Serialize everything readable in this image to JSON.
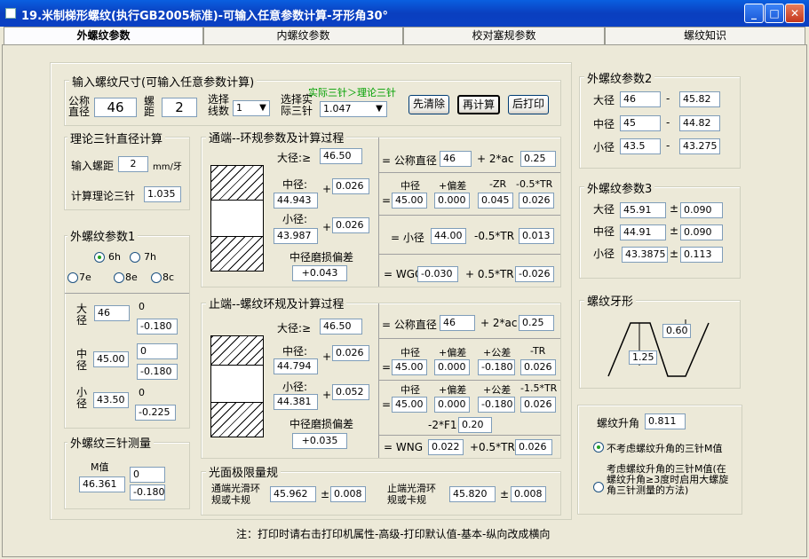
{
  "window": {
    "title": "19.米制梯形螺纹(执行GB2005标准)-可输入任意参数计算-牙形角30°"
  },
  "tabs": [
    "外螺纹参数",
    "内螺纹参数",
    "校对塞规参数",
    "螺纹知识"
  ],
  "input_group": {
    "title": "输入螺纹尺寸(可输入任意参数计算)",
    "nominal_label": "公称直径",
    "nominal_value": "46",
    "pitch_label": "螺距",
    "pitch_value": "2",
    "thread_count_label": "选择线数",
    "thread_count_value": "1",
    "actual_pin_label": "选择实际三针",
    "actual_pin_value": "1.047",
    "pin_note": "实际三针＞理论三针",
    "clear_button": "先清除",
    "recalc_button": "再计算",
    "print_button": "后打印"
  },
  "theory_pin": {
    "title": "理论三针直径计算",
    "pitch_label": "输入螺距",
    "pitch_value": "2",
    "unit": "mm/牙",
    "calc_label": "计算理论三针",
    "calc_value": "1.035"
  },
  "ext_params1": {
    "title": "外螺纹参数1",
    "tolerances": [
      "6h",
      "7h",
      "7e",
      "8e",
      "8c"
    ],
    "selected": "6h",
    "major_label": "大径",
    "major_value": "46",
    "major_upper": "0",
    "major_lower": "-0.180",
    "pitch_label": "中径",
    "pitch_value": "45.00",
    "pitch_upper": "0",
    "pitch_lower": "-0.180",
    "minor_label": "小径",
    "minor_value": "43.50",
    "minor_upper": "0",
    "minor_lower": "-0.225"
  },
  "three_pin": {
    "title": "外螺纹三针测量",
    "m_label": "M值",
    "m_value": "46.361",
    "upper": "0",
    "lower": "-0.180"
  },
  "go_ring": {
    "title": "通端--环规参数及计算过程",
    "major_label": "大径:≥",
    "major_value": "46.50",
    "pitch_label": "中径:",
    "pitch_value": "44.943",
    "pitch_plus": "0.026",
    "minor_label": "小径:",
    "minor_value": "43.987",
    "minor_plus": "0.026",
    "wear_label": "中径磨损偏差",
    "wear_value": "+0.043",
    "r1_label": "= 公称直径",
    "r1_value": "46",
    "r1_op": "+ 2*ac",
    "r1_ac": "0.25",
    "r2_headers": [
      "中径",
      "+偏差",
      "-ZR",
      "-0.5*TR"
    ],
    "r2_values": [
      "45.00",
      "0.000",
      "0.045",
      "0.026"
    ],
    "r3_label": "= 小径",
    "r3_value": "44.00",
    "r3_op": "-0.5*TR",
    "r3_tr": "0.013",
    "r4_label": "= WGO",
    "r4_value": "-0.030",
    "r4_op": "+ 0.5*TR",
    "r4_tr": "-0.026"
  },
  "nogo_ring": {
    "title": "止端--螺纹环规及计算过程",
    "major_label": "大径:≥",
    "major_value": "46.50",
    "pitch_label": "中径:",
    "pitch_value": "44.794",
    "pitch_plus": "0.026",
    "minor_label": "小径:",
    "minor_value": "44.381",
    "minor_plus": "0.052",
    "wear_label": "中径磨损偏差",
    "wear_value": "+0.035",
    "r1_label": "= 公称直径",
    "r1_value": "46",
    "r1_op": "+ 2*ac",
    "r1_ac": "0.25",
    "r2_headers": [
      "中径",
      "+偏差",
      "+公差",
      "-TR"
    ],
    "r2_values": [
      "45.00",
      "0.000",
      "-0.180",
      "0.026"
    ],
    "r3_headers": [
      "中径",
      "+偏差",
      "+公差",
      "-1.5*TR"
    ],
    "r3_values": [
      "45.00",
      "0.000",
      "-0.180",
      "0.026"
    ],
    "r3_f1_label": "-2*F1",
    "r3_f1_value": "0.20",
    "r4_label": "= WNG",
    "r4_value": "0.022",
    "r4_op": "+0.5*TR",
    "r4_tr": "0.026"
  },
  "smooth_gauge": {
    "title": "光面极限量规",
    "go_label": "通端光滑环规或卡规",
    "go_value": "45.962",
    "go_pm": "±",
    "go_tol": "0.008",
    "nogo_label": "止端光滑环规或卡规",
    "nogo_value": "45.820",
    "nogo_pm": "±",
    "nogo_tol": "0.008"
  },
  "ext_params2": {
    "title": "外螺纹参数2",
    "rows": [
      {
        "label": "大径",
        "a": "46",
        "b": "45.82"
      },
      {
        "label": "中径",
        "a": "45",
        "b": "44.82"
      },
      {
        "label": "小径",
        "a": "43.5",
        "b": "43.275"
      }
    ],
    "dash": "-"
  },
  "ext_params3": {
    "title": "外螺纹参数3",
    "rows": [
      {
        "label": "大径",
        "a": "45.91",
        "b": "0.090"
      },
      {
        "label": "中径",
        "a": "44.91",
        "b": "0.090"
      },
      {
        "label": "小径",
        "a": "43.3875",
        "b": "0.113"
      }
    ],
    "pm": "±"
  },
  "profile": {
    "title": "螺纹牙形",
    "top_value": "0.60",
    "side_value": "1.25"
  },
  "lead": {
    "label": "螺纹升角",
    "value": "0.811",
    "opt1": "不考虑螺纹升角的三针M值",
    "opt2": "考虑螺纹升角的三针M值(在螺纹升角≥3度时启用大螺旋角三针测量的方法)",
    "selected": 1
  },
  "footer_note": "注：打印时请右击打印机属性-高级-打印默认值-基本-纵向改成横向",
  "colors": {
    "title_bar": "#0A3FBF",
    "note_green": "#00A000"
  }
}
